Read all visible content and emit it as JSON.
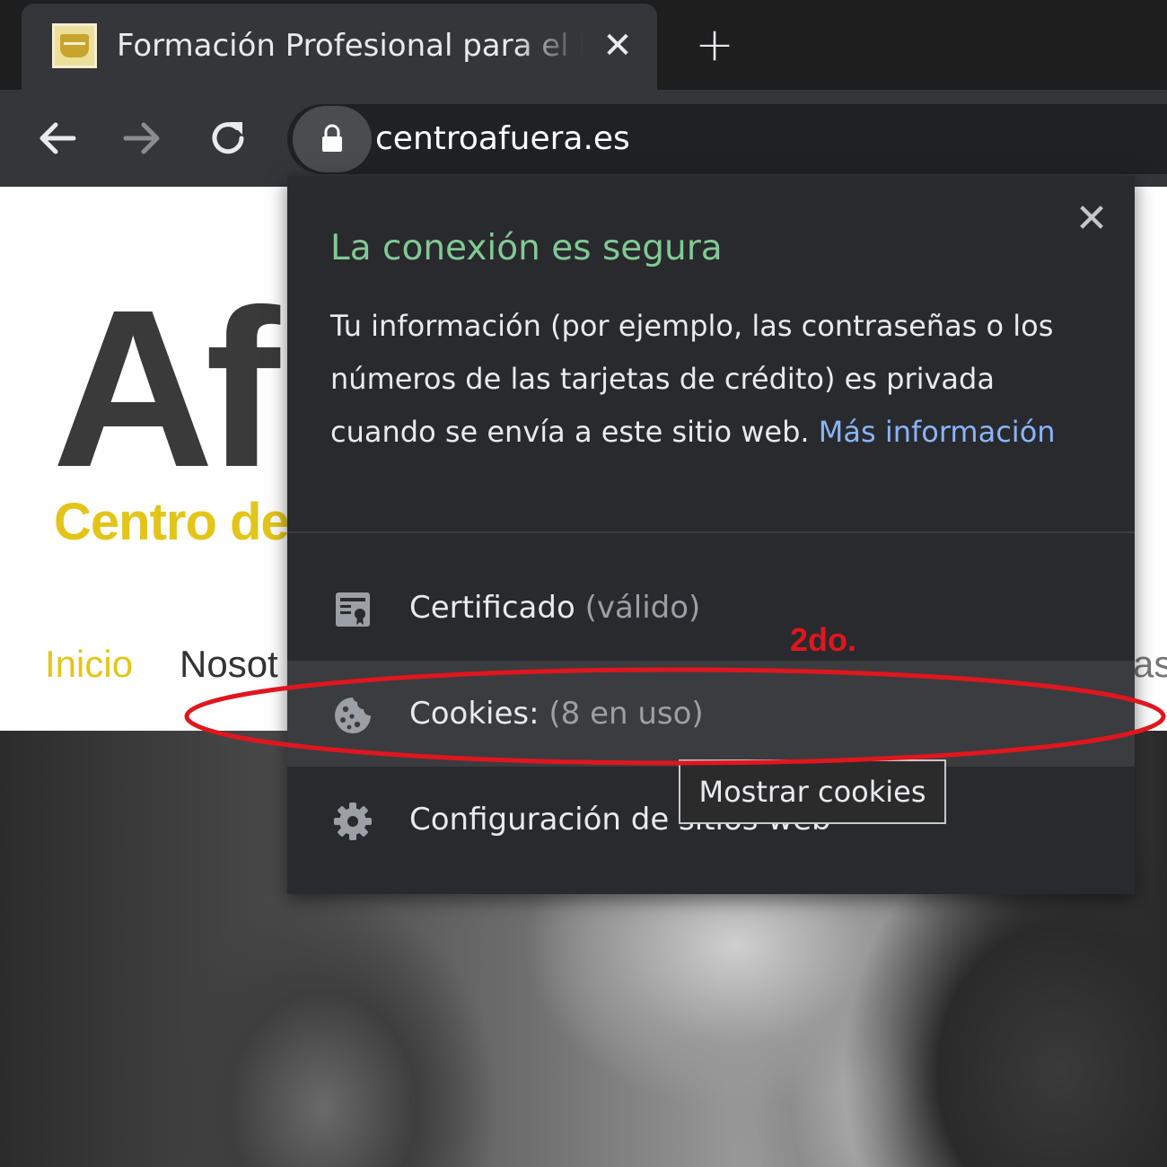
{
  "browser": {
    "tab": {
      "title": "Formación Profesional para el Em",
      "close_glyph": "✕",
      "favicon": "shield-favicon"
    },
    "new_tab_glyph": "+",
    "nav": {
      "back_icon": "arrow-left-icon",
      "forward_icon": "arrow-right-icon",
      "reload_icon": "reload-icon"
    },
    "omnibox": {
      "lock_icon": "lock-icon",
      "url": "centroafuera.es"
    }
  },
  "page": {
    "logo_text": "Af",
    "logo_subtitle": "Centro de",
    "menu": {
      "inicio": "Inicio",
      "nosotros": "Nosot",
      "tail": "as"
    }
  },
  "popup": {
    "close_glyph": "✕",
    "title": "La conexión es segura",
    "description": "Tu información (por ejemplo, las contraseñas o los números de las tarjetas de crédito) es privada cuando se envía a este sitio web.",
    "link": "Más información",
    "rows": [
      {
        "icon": "certificate-icon",
        "label": "Certificado",
        "detail": "(válido)"
      },
      {
        "icon": "cookie-icon",
        "label": "Cookies:",
        "detail": "(8 en uso)"
      },
      {
        "icon": "gear-icon",
        "label": "Configuración de sitios web",
        "detail": ""
      }
    ]
  },
  "tooltip": "Mostrar cookies",
  "annotation": {
    "label": "2do.",
    "color": "#e0161e"
  },
  "colors": {
    "secure_green": "#81c995",
    "link_blue": "#8ab4f8",
    "brand_yellow": "#e3c51a"
  }
}
